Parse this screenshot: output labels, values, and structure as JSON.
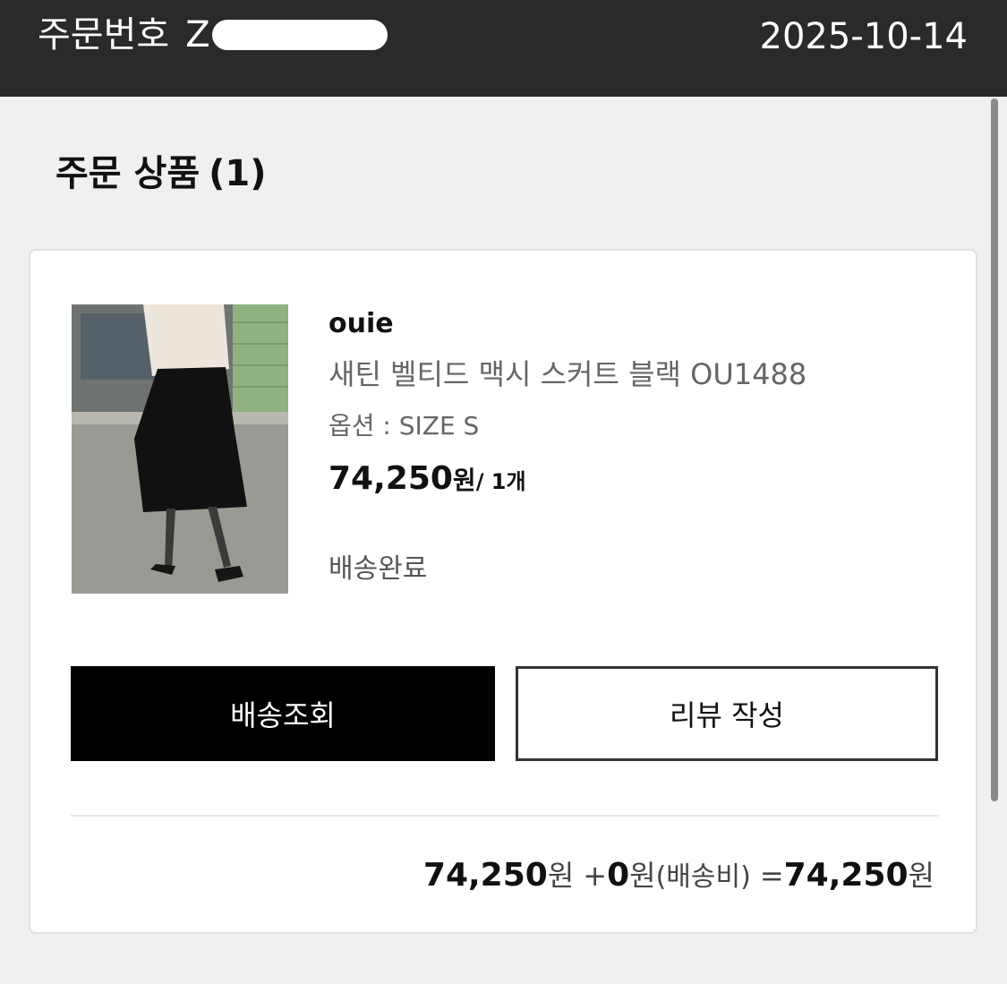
{
  "header": {
    "order_label": "주문번호",
    "order_number_prefix": "Z",
    "date": "2025-10-14",
    "background": "#2a2a2a"
  },
  "section": {
    "title": "주문 상품",
    "count": "(1)"
  },
  "item": {
    "brand": "ouie",
    "name": "새틴 벨티드 맥시 스커트 블랙 OU1488",
    "option": "옵션 : SIZE S",
    "price": "74,250",
    "price_unit": "원",
    "quantity": "/ 1개",
    "status": "배송완료",
    "image_icon": "product-photo"
  },
  "buttons": {
    "track_label": "배송조회",
    "review_label": "리뷰 작성"
  },
  "total": {
    "item_amount": "74,250",
    "unit_1": "원",
    "plus": "+",
    "shipping_amount": "0",
    "unit_2": "원",
    "shipping_label": "(배송비)",
    "equals": "=",
    "grand_total": "74,250",
    "unit_3": "원"
  }
}
